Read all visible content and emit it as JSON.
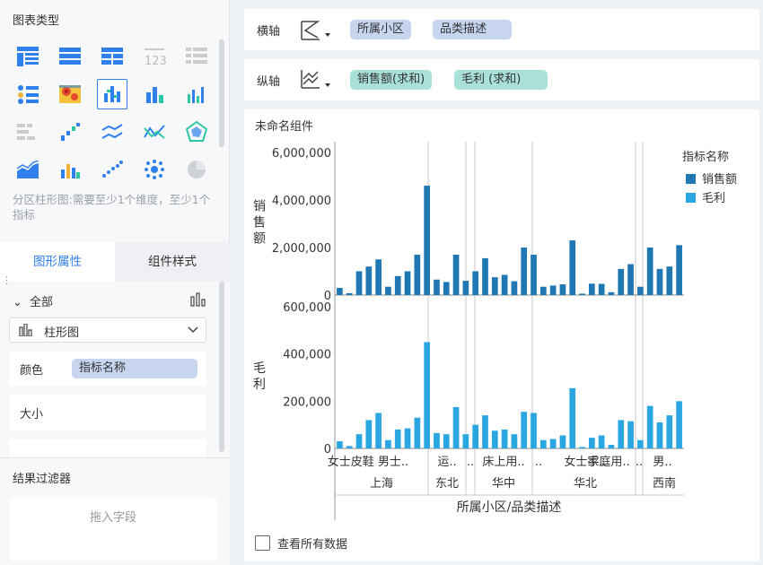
{
  "left_panel": {
    "chart_type_title": "图表类型",
    "hint": "分区柱形图:需要至少1个维度，至少1个指标",
    "tab_graph": "图形属性",
    "tab_style": "组件样式",
    "all_label": "全部",
    "chart_select": "柱形图",
    "color_label": "颜色",
    "color_field": "指标名称",
    "size_label": "大小",
    "filter_title": "结果过滤器",
    "filter_drop": "拖入字段"
  },
  "axes": {
    "x_label": "横轴",
    "x_fields": [
      "所属小区",
      "品类描述"
    ],
    "y_label": "纵轴",
    "y_fields": [
      "销售额(求和)",
      "毛利 (求和)"
    ]
  },
  "chart_card": {
    "title": "未命名组件",
    "view_all": "查看所有数据"
  },
  "chart_data": {
    "type": "bar",
    "legend_title": "指标名称",
    "legend_position": "right",
    "series": [
      {
        "name": "销售额",
        "color": "#1f77b4",
        "values": [
          300000,
          80000,
          1000000,
          1200000,
          1500000,
          350000,
          800000,
          1000000,
          1700000,
          4600000,
          650000,
          550000,
          1700000,
          600000,
          1000000,
          1550000,
          750000,
          850000,
          580000,
          2000000,
          1700000,
          350000,
          400000,
          450000,
          2300000,
          60000,
          480000,
          470000,
          120000,
          1100000,
          1300000,
          350000,
          2000000,
          1100000,
          1200000,
          2100000
        ],
        "ylabel": "销售额",
        "ylim": [
          0,
          6000000
        ],
        "ticks": [
          "0",
          "2,000,000",
          "4,000,000",
          "6,000,000"
        ]
      },
      {
        "name": "毛利",
        "color": "#2aa7e0",
        "values": [
          30000,
          10000,
          60000,
          120000,
          150000,
          35000,
          80000,
          85000,
          130000,
          450000,
          65000,
          60000,
          175000,
          60000,
          100000,
          140000,
          75000,
          80000,
          60000,
          155000,
          150000,
          35000,
          40000,
          55000,
          255000,
          6000,
          45000,
          55000,
          15000,
          120000,
          115000,
          35000,
          180000,
          110000,
          140000,
          200000
        ],
        "ylabel": "毛利",
        "ylim": [
          0,
          600000
        ],
        "ticks": [
          "0",
          "200,000",
          "400,000",
          "600,000"
        ]
      }
    ],
    "category_labels": [
      "女士皮鞋 男士..",
      "运..",
      "..",
      "床上用..",
      "..",
      "女士手..",
      "家庭用..",
      "..",
      "男.."
    ],
    "regions": [
      "上海",
      "东北",
      "华中",
      "华北",
      "西南"
    ],
    "xlabel": "所属小区/品类描述"
  }
}
